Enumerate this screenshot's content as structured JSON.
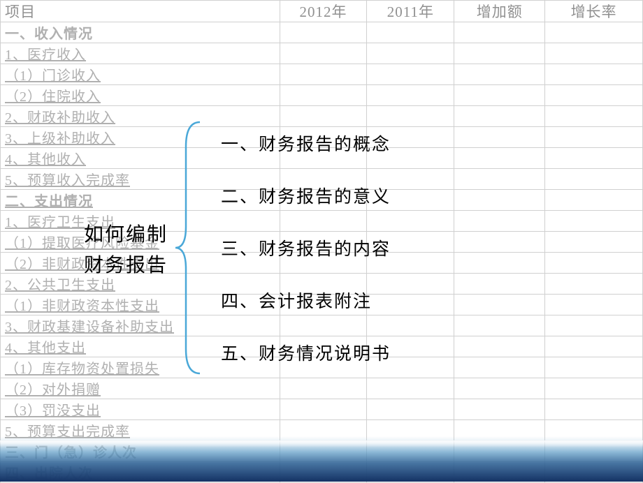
{
  "table": {
    "headers": [
      "项目",
      "2012年",
      "2011年",
      "增加额",
      "增长率"
    ],
    "rows": [
      {
        "label": "一、收入情况",
        "bold": true
      },
      {
        "label": "1、医疗收入",
        "underline": true
      },
      {
        "label": "（1）门诊收入",
        "underline": true
      },
      {
        "label": "（2）住院收入",
        "underline": true
      },
      {
        "label": "2、财政补助收入",
        "underline": true
      },
      {
        "label": "3、上级补助收入",
        "underline": true
      },
      {
        "label": "4、其他收入",
        "underline": true
      },
      {
        "label": "5、预算收入完成率",
        "underline": true
      },
      {
        "label": "二、支出情况",
        "bold": true,
        "underline": true
      },
      {
        "label": "1、医疗卫生支出",
        "underline": true
      },
      {
        "label": "（1）提取医疗风险基金",
        "underline": true
      },
      {
        "label": "（2）非财政资本性支出",
        "underline": true
      },
      {
        "label": "2、公共卫生支出",
        "underline": true
      },
      {
        "label": "（1）非财政资本性支出",
        "underline": true
      },
      {
        "label": "3、财政基建设备补助支出",
        "underline": true
      },
      {
        "label": "4、其他支出",
        "underline": true
      },
      {
        "label": "（1）库存物资处置损失",
        "underline": true
      },
      {
        "label": "（2）对外捐赠",
        "underline": true
      },
      {
        "label": "（3）罚没支出",
        "underline": true
      },
      {
        "label": "5、预算支出完成率",
        "underline": true
      },
      {
        "label": "三、门（急）诊人次",
        "bold": true
      },
      {
        "label": "四、出院人次",
        "bold": true
      }
    ]
  },
  "overlay": {
    "title_line1": "如何编制",
    "title_line2": "财务报告",
    "topics": [
      "一、财务报告的概念",
      "二、财务报告的意义",
      "三、财务报告的内容",
      "四、会计报表附注",
      "五、财务情况说明书"
    ]
  }
}
